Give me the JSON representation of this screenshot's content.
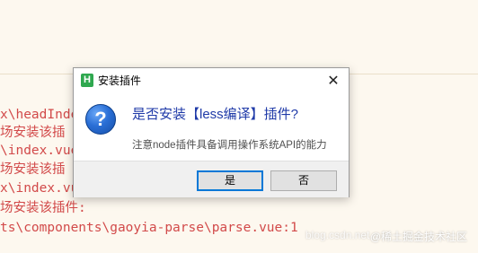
{
  "console": {
    "lines": [
      "x\\headInde",
      "场安装该插",
      "\\index.vue",
      "场安装该插",
      "x\\index.vue:1",
      "场安装该插件:",
      "ts\\components\\gaoyia-parse\\parse.vue:1"
    ]
  },
  "watermark": {
    "url_text": "blog.csdn.net",
    "brand_text": "@稀土掘金技术社区"
  },
  "dialog": {
    "app_icon_letter": "H",
    "title": "安装插件",
    "close_label": "✕",
    "question_glyph": "?",
    "main_message": "是否安装【less编译】插件?",
    "sub_message": "注意node插件具备调用操作系统API的能力",
    "yes_label": "是",
    "no_label": "否"
  },
  "colors": {
    "console_text": "#d24a4a",
    "editor_bg": "#fdf8ef",
    "main_message": "#1f3aa8",
    "default_button_border": "#0078d7"
  }
}
